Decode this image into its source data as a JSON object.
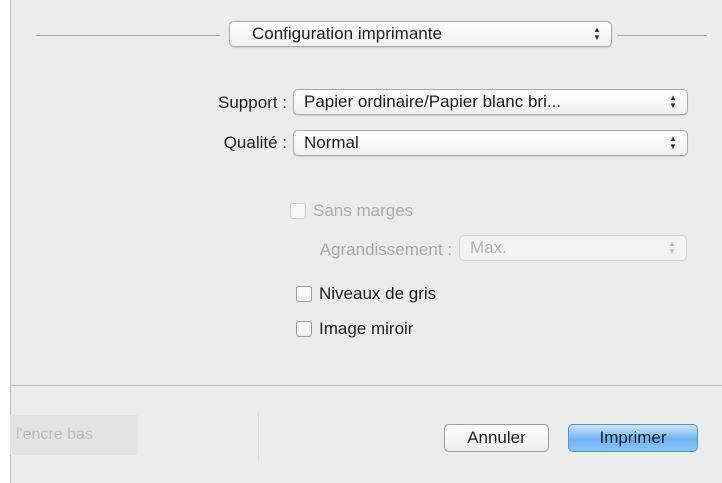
{
  "header": {
    "preset_popup": "Configuration imprimante"
  },
  "settings": {
    "support_label": "Support :",
    "support_value": "Papier ordinaire/Papier blanc bri...",
    "quality_label": "Qualité :",
    "quality_value": "Normal",
    "borderless_label": "Sans marges",
    "enlarge_label": "Agrandissement :",
    "enlarge_value": "Max.",
    "grayscale_label": "Niveaux de gris",
    "mirror_label": "Image miroir"
  },
  "footer": {
    "ink_low_text": "l'encre bas",
    "cancel_label": "Annuler",
    "print_label": "Imprimer"
  }
}
